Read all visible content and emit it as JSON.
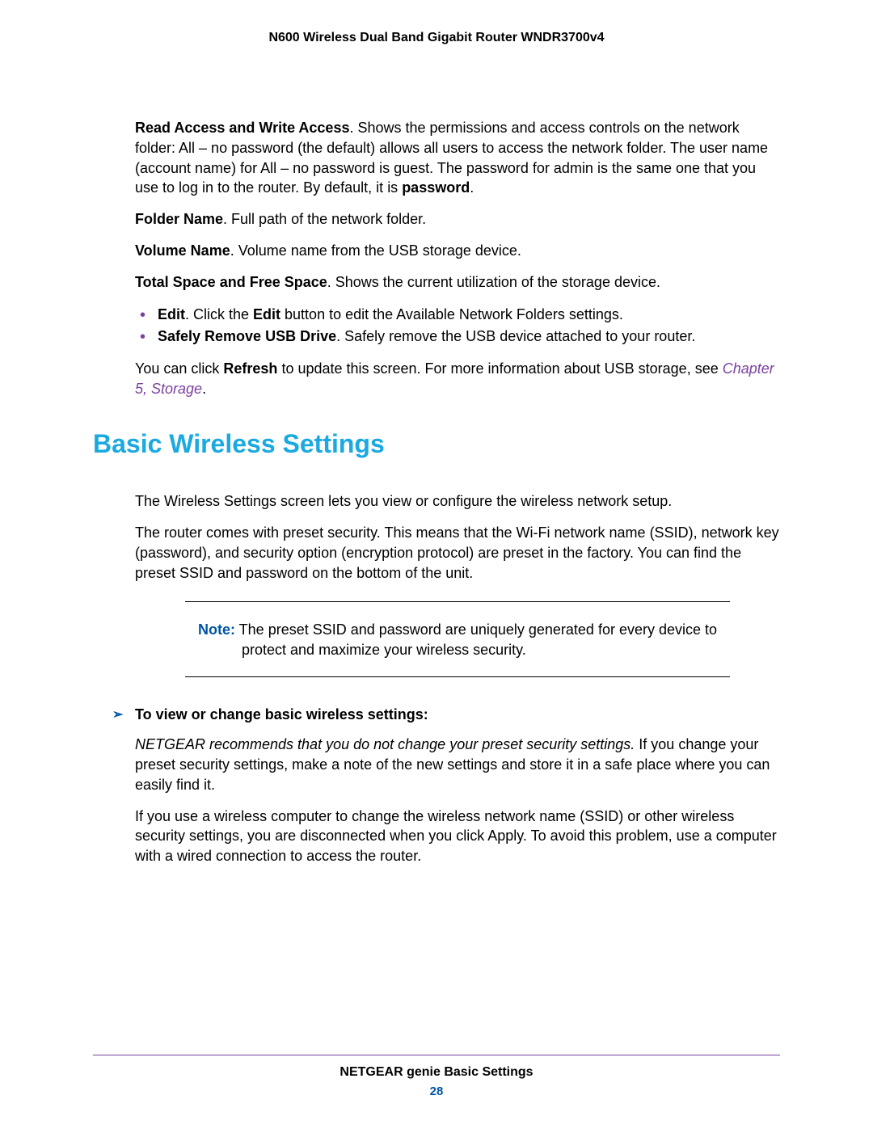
{
  "header": {
    "title": "N600 Wireless Dual Band Gigabit Router WNDR3700v4"
  },
  "body": {
    "readAccess": {
      "label": "Read Access and Write Access",
      "text": ". Shows the permissions and access controls on the network folder: All – no password (the default) allows all users to access the network folder. The user name (account name) for All – no password is guest. The password for admin is the same one that you use to log in to the router. By default, it is ",
      "endBold": "password",
      "endPunct": "."
    },
    "folderName": {
      "label": "Folder Name",
      "text": ". Full path of the network folder."
    },
    "volumeName": {
      "label": "Volume Name",
      "text": ". Volume name from the USB storage device."
    },
    "totalSpace": {
      "label": "Total Space and Free Space",
      "text": ". Shows the current utilization of the storage device."
    },
    "editBullet": {
      "label": "Edit",
      "mid": ". Click the ",
      "label2": "Edit",
      "text": " button to edit the Available Network Folders settings."
    },
    "safelyBullet": {
      "label": "Safely Remove USB Drive",
      "text": ". Safely remove the USB device attached to your router."
    },
    "refresh": {
      "pre": "You can click ",
      "bold": "Refresh",
      "post": " to update this screen. For more information about USB storage, see ",
      "link": "Chapter 5, Storage",
      "end": "."
    },
    "sectionHeading": "Basic Wireless Settings",
    "wireless1": "The Wireless Settings screen lets you view or configure the wireless network setup.",
    "wireless2": "The router comes with preset security. This means that the Wi-Fi network name (SSID), network key (password), and security option (encryption protocol) are preset in the factory. You can find the preset SSID and password on the bottom of the unit.",
    "note": {
      "label": "Note:",
      "text": " The preset SSID and password are uniquely generated for every device to protect and maximize your wireless security."
    },
    "stepsHeading": "To view or change basic wireless settings:",
    "recommend": {
      "italic": "NETGEAR recommends that you do not change your preset security settings.",
      "text": " If you change your preset security settings, make a note of the new settings and store it in a safe place where you can easily find it."
    },
    "wiredNote": "If you use a wireless computer to change the wireless network name (SSID) or other wireless security settings, you are disconnected when you click Apply. To avoid this problem, use a computer with a wired connection to access the router."
  },
  "footer": {
    "title": "NETGEAR genie Basic Settings",
    "page": "28"
  }
}
